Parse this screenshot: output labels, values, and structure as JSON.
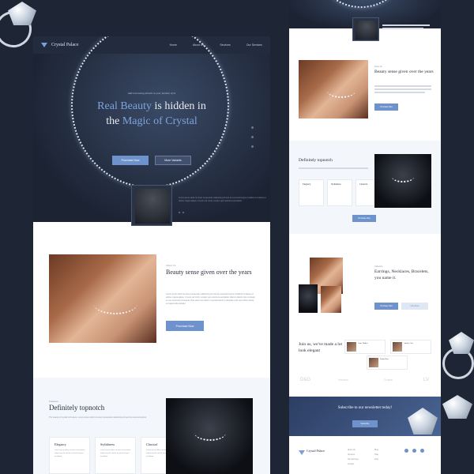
{
  "brand": {
    "name": "Crystal Palace"
  },
  "nav": {
    "items": [
      "Home",
      "About Us",
      "Services",
      "Our Services"
    ]
  },
  "hero": {
    "tagline": "Add increasing details to your fashion style",
    "title_a": "Real Beauty",
    "title_b": " is hidden in",
    "title_c": "the ",
    "title_d": "Magic of Crystal",
    "btn_primary": "Purchase Now",
    "btn_secondary": "More Variants"
  },
  "product": {
    "title": "Diamond Carbine Infinity",
    "desc": "Lorem ipsum dolor sit amet consectetur adipiscing elit sed do eiusmod tempor incididunt ut labore et dolore magna aliqua. Ut enim ad minim veniam quis nostrud exercitation."
  },
  "about": {
    "kicker": "About Us",
    "title": "Beauty sense given over the years",
    "body": "Lorem ipsum dolor sit amet consectetur adipiscing elit sed do eiusmod tempor incididunt ut labore et dolore magna aliqua. Ut enim ad minim veniam quis nostrud exercitation ullamco laboris nisi ut aliquip ex ea commodo consequat. Duis aute irure dolor in reprehenderit in voluptate velit esse cillum dolore eu fugiat nulla pariatur.",
    "cta": "Purchase Now"
  },
  "features": {
    "kicker": "Features",
    "title": "Definitely topnotch",
    "body": "The beauty of crystal is timeless. Lorem ipsum dolor sit amet consectetur adipiscing elit sed do eiusmod tempor.",
    "cards": [
      {
        "title": "Elegancy",
        "desc": "Lorem ipsum dolor sit amet consectetur adipiscing elit sed do eiusmod tempor incididunt."
      },
      {
        "title": "Stylishness",
        "desc": "Lorem ipsum dolor sit amet consectetur adipiscing elit sed do eiusmod tempor incididunt."
      },
      {
        "title": "Classical",
        "desc": "Lorem ipsum dolor sit amet consectetur adipiscing elit sed do eiusmod tempor incididunt."
      }
    ],
    "cta": "Purchase Now"
  },
  "collection": {
    "kicker": "Collection",
    "title": "Earrings, Necklaces, Bracelets, you name it.",
    "btn_primary": "Purchase Now",
    "btn_secondary": "View More"
  },
  "testimonials": {
    "title": "Join us, we've made a lot look elegant",
    "people": [
      "Anne Walker",
      "Ashley Cole",
      "Emily Rose"
    ]
  },
  "brands": [
    "D&G",
    "Versace",
    "Chanel",
    "LV"
  ],
  "newsletter": {
    "title": "Subscribe to our newsletter today!",
    "cta": "Subscribe"
  },
  "footer": {
    "brand": "Crystal Palace",
    "cols": [
      [
        "About Us",
        "Services",
        "Our Services",
        "Contact"
      ],
      [
        "Blog",
        "Help",
        "FAQ"
      ]
    ]
  }
}
